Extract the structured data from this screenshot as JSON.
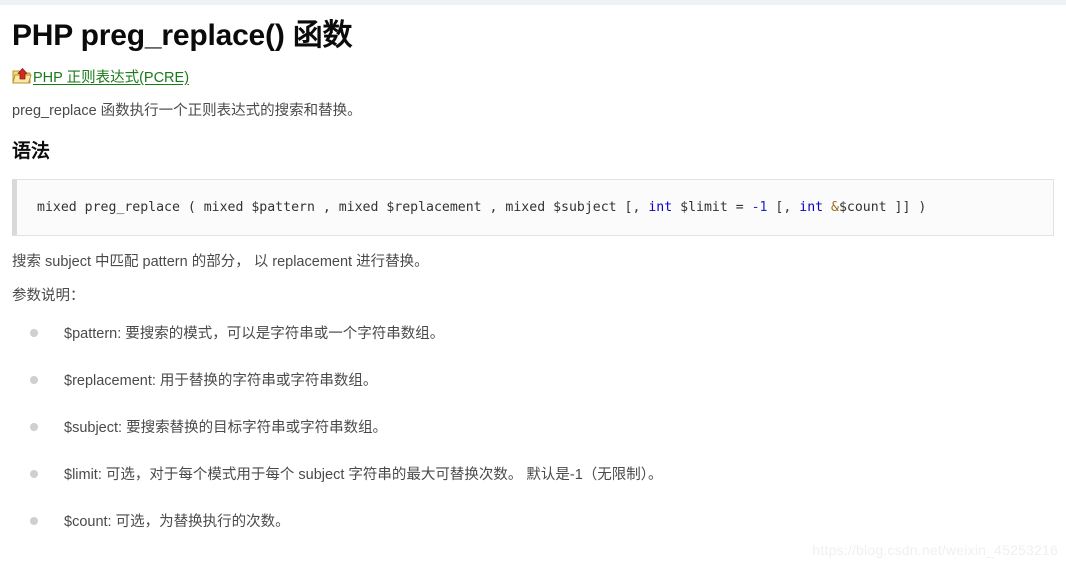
{
  "page": {
    "title": "PHP preg_replace() 函数",
    "parent_link": {
      "icon": "folder-up-icon",
      "label": "PHP 正则表达式(PCRE)"
    },
    "intro": "preg_replace 函数执行一个正则表达式的搜索和替换。",
    "section_heading": "语法",
    "description": "搜索 subject 中匹配 pattern 的部分， 以 replacement 进行替换。",
    "params_label": "参数说明："
  },
  "code": {
    "tokens": [
      {
        "text": "mixed preg_replace ( mixed $pattern , mixed $replacement , mixed $subject [, ",
        "kind": "plain"
      },
      {
        "text": "int",
        "kind": "type"
      },
      {
        "text": " $limit = ",
        "kind": "plain"
      },
      {
        "text": "-1",
        "kind": "num"
      },
      {
        "text": " [, ",
        "kind": "plain"
      },
      {
        "text": "int",
        "kind": "type"
      },
      {
        "text": " ",
        "kind": "plain"
      },
      {
        "text": "&",
        "kind": "amp"
      },
      {
        "text": "$count ]] )",
        "kind": "plain"
      }
    ],
    "plain_text": "mixed preg_replace ( mixed $pattern , mixed $replacement , mixed $subject [, int $limit = -1 [, int &$count ]] )"
  },
  "params": [
    {
      "name": "$pattern",
      "text": "$pattern: 要搜索的模式，可以是字符串或一个字符串数组。"
    },
    {
      "name": "$replacement",
      "text": "$replacement: 用于替换的字符串或字符串数组。"
    },
    {
      "name": "$subject",
      "text": "$subject: 要搜索替换的目标字符串或字符串数组。"
    },
    {
      "name": "$limit",
      "text": "$limit: 可选，对于每个模式用于每个 subject 字符串的最大可替换次数。 默认是-1（无限制）。"
    },
    {
      "name": "$count",
      "text": "$count: 可选，为替换执行的次数。"
    }
  ],
  "watermark": "https://blog.csdn.net/weixin_45253216",
  "colors": {
    "link": "#1a7a1a",
    "code_type": "#0a00c8",
    "code_number": "#1d2bbf",
    "code_amp": "#9a6b1b",
    "bullet": "#cfcfcf",
    "code_bg": "#fbfbfb",
    "code_border": "#e2e2e2",
    "watermark": "#f0f0f0"
  }
}
